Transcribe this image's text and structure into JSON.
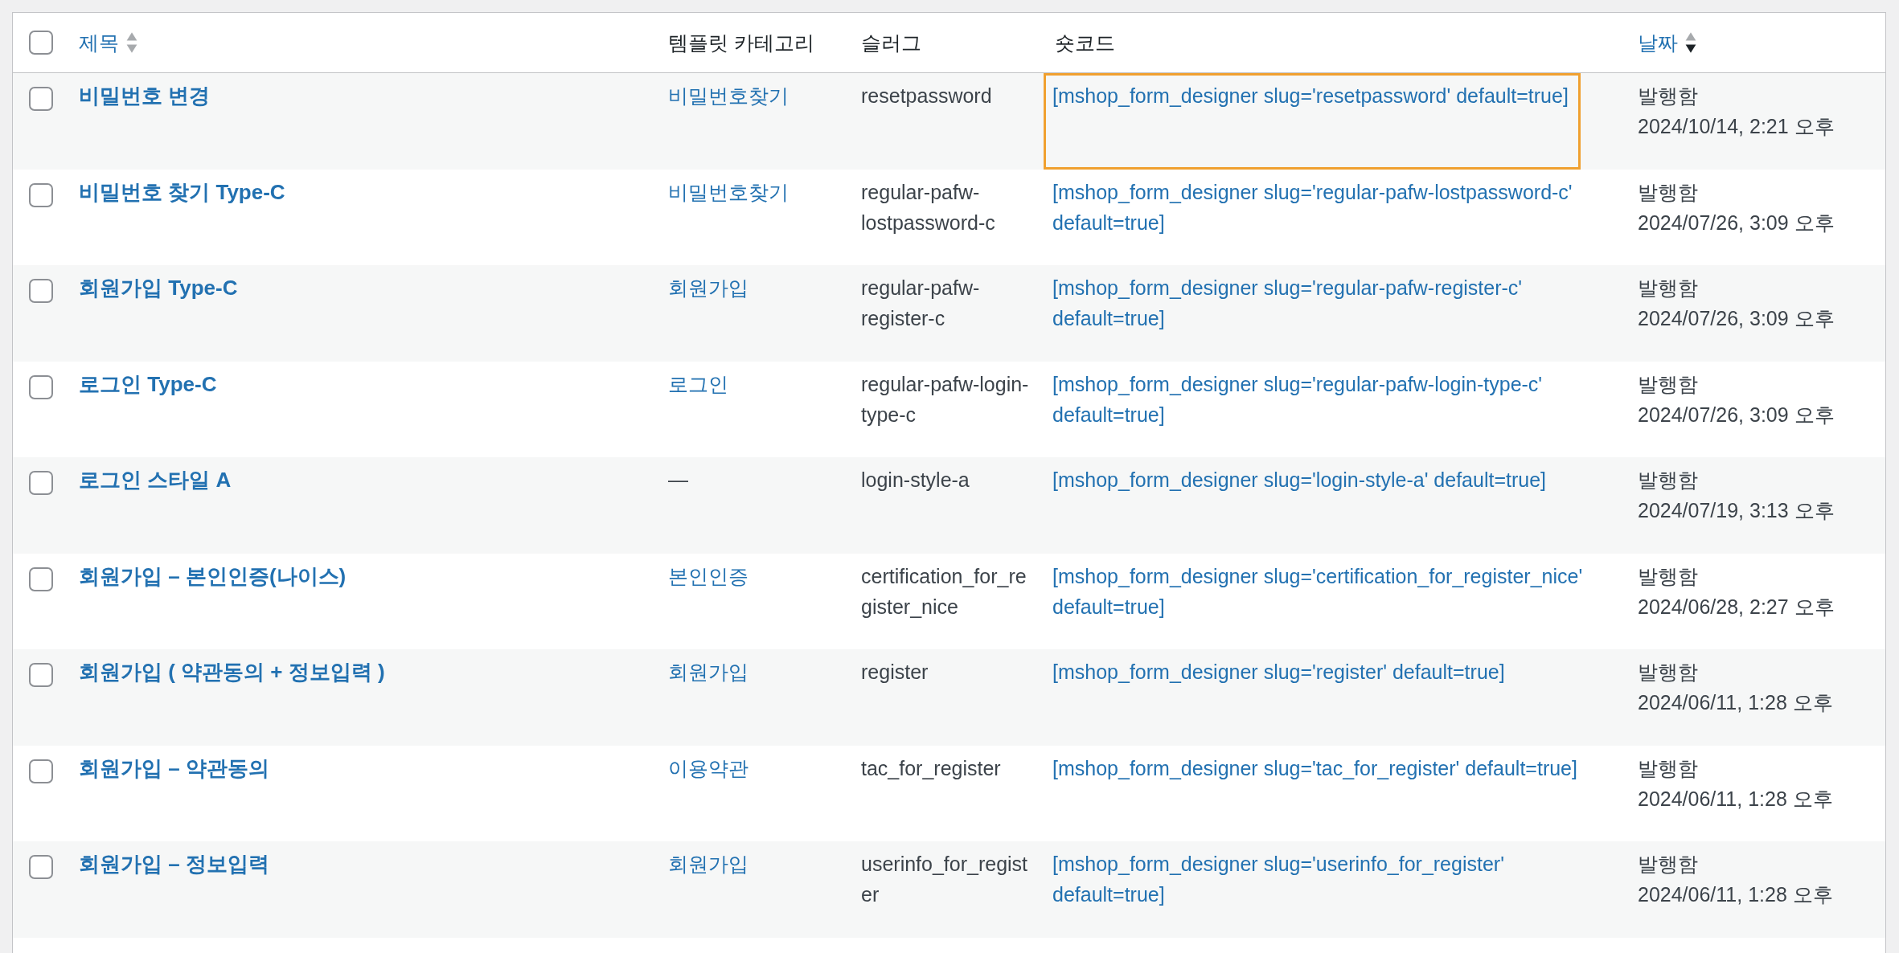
{
  "header": {
    "select_all": {
      "checked": false
    },
    "columns": [
      {
        "label": "제목",
        "sortable": true,
        "sorted": false
      },
      {
        "label": "템플릿 카테고리",
        "sortable": false,
        "sorted": false
      },
      {
        "label": "슬러그",
        "sortable": false,
        "sorted": false
      },
      {
        "label": "숏코드",
        "sortable": false,
        "sorted": false
      },
      {
        "label": "날짜",
        "sortable": true,
        "sorted": true
      }
    ]
  },
  "rows": [
    {
      "checked": false,
      "title": "비밀번호 변경",
      "category": "비밀번호찾기",
      "category_link": true,
      "slug": "resetpassword",
      "shortcode": "[mshop_form_designer slug='resetpassword' default=true]",
      "highlighted": true,
      "status": "발행함",
      "date": "2024/10/14, 2:21 오후"
    },
    {
      "checked": false,
      "title": "비밀번호 찾기 Type-C",
      "category": "비밀번호찾기",
      "category_link": true,
      "slug": "regular-pafw-lostpassword-c",
      "shortcode": "[mshop_form_designer slug='regular-pafw-lostpassword-c' default=true]",
      "highlighted": false,
      "status": "발행함",
      "date": "2024/07/26, 3:09 오후"
    },
    {
      "checked": false,
      "title": "회원가입 Type-C",
      "category": "회원가입",
      "category_link": true,
      "slug": "regular-pafw-register-c",
      "shortcode": "[mshop_form_designer slug='regular-pafw-register-c' default=true]",
      "highlighted": false,
      "status": "발행함",
      "date": "2024/07/26, 3:09 오후"
    },
    {
      "checked": false,
      "title": "로그인 Type-C",
      "category": "로그인",
      "category_link": true,
      "slug": "regular-pafw-login-type-c",
      "shortcode": "[mshop_form_designer slug='regular-pafw-login-type-c' default=true]",
      "highlighted": false,
      "status": "발행함",
      "date": "2024/07/26, 3:09 오후"
    },
    {
      "checked": false,
      "title": "로그인 스타일 A",
      "category": "—",
      "category_link": false,
      "slug": "login-style-a",
      "shortcode": "[mshop_form_designer slug='login-style-a' default=true]",
      "highlighted": false,
      "status": "발행함",
      "date": "2024/07/19, 3:13 오후"
    },
    {
      "checked": false,
      "title": "회원가입 – 본인인증(나이스)",
      "category": "본인인증",
      "category_link": true,
      "slug": "certification_for_register_nice",
      "shortcode": "[mshop_form_designer slug='certification_for_register_nice' default=true]",
      "highlighted": false,
      "status": "발행함",
      "date": "2024/06/28, 2:27 오후"
    },
    {
      "checked": false,
      "title": "회원가입 ( 약관동의 + 정보입력 )",
      "category": "회원가입",
      "category_link": true,
      "slug": "register",
      "shortcode": "[mshop_form_designer slug='register' default=true]",
      "highlighted": false,
      "status": "발행함",
      "date": "2024/06/11, 1:28 오후"
    },
    {
      "checked": false,
      "title": "회원가입 – 약관동의",
      "category": "이용약관",
      "category_link": true,
      "slug": "tac_for_register",
      "shortcode": "[mshop_form_designer slug='tac_for_register' default=true]",
      "highlighted": false,
      "status": "발행함",
      "date": "2024/06/11, 1:28 오후"
    },
    {
      "checked": false,
      "title": "회원가입 – 정보입력",
      "category": "회원가입",
      "category_link": true,
      "slug": "userinfo_for_register",
      "shortcode": "[mshop_form_designer slug='userinfo_for_register' default=true]",
      "highlighted": false,
      "status": "발행함",
      "date": "2024/06/11, 1:28 오후"
    }
  ]
}
